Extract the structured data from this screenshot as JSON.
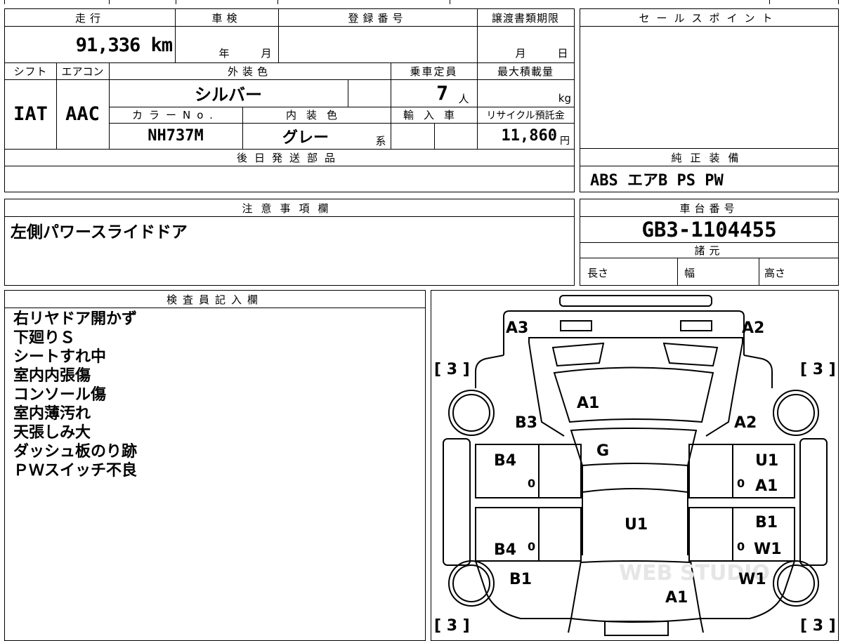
{
  "vehicle_info": {
    "headers": {
      "mileage": "走行",
      "inspection": "車検",
      "registration_no": "登録番号",
      "transfer_deadline": "譲渡書類期限",
      "shift": "シフト",
      "aircon": "エアコン",
      "exterior_color": "外装色",
      "capacity": "乗車定員",
      "max_load": "最大積載量",
      "color_no": "カラーNo.",
      "interior_color": "内装色",
      "import": "輸入車",
      "recycle_fee": "リサイクル預託金",
      "later_parts": "後日発送部品"
    },
    "mileage": "91,336 km",
    "inspection_year_unit": "年",
    "inspection_month_unit": "月",
    "deadline_month_unit": "月",
    "deadline_day_unit": "日",
    "shift": "IAT",
    "aircon": "AAC",
    "exterior_color": "シルバー",
    "capacity": "7",
    "capacity_unit": "人",
    "max_load_unit": "kg",
    "color_no": "NH737M",
    "interior_color": "グレー",
    "interior_suffix": "系",
    "recycle_fee": "11,860",
    "recycle_unit": "円"
  },
  "sale_points": {
    "header": "セールスポイント"
  },
  "genuine_equipment": {
    "header": "純正装備",
    "value": "ABS エアB PS PW"
  },
  "caution": {
    "header": "注意事項欄",
    "text": "左側パワースライドドア"
  },
  "chassis": {
    "header": "車台番号",
    "value": "GB3-1104455"
  },
  "specs": {
    "header": "諸元",
    "length": "長さ",
    "width": "幅",
    "height": "高さ"
  },
  "inspector_notes": {
    "header": "検査員記入欄",
    "lines": [
      "右リヤドア開かず",
      "下廻りＳ",
      "シートすれ中",
      "室内内張傷",
      "コンソール傷",
      "室内薄汚れ",
      "天張しみ大",
      "ダッシュ板のり跡",
      "ＰＷスイッチ不良"
    ]
  },
  "diagram": {
    "tire_tl": "[ 3 ]",
    "tire_tr": "[ 3 ]",
    "tire_bl": "[ 3 ]",
    "tire_br": "[ 3 ]",
    "a3": "A3",
    "a2_top": "A2",
    "a1_hood": "A1",
    "b3": "B3",
    "a2_right": "A2",
    "g": "G",
    "b4_upper": "B4",
    "u1_right": "U1",
    "a1_right": "A1",
    "u1_center": "U1",
    "b1_right": "B1",
    "b4_lower": "B4",
    "w1_right": "W1",
    "b1_left": "B1",
    "w1_rear": "W1",
    "a1_rear": "A1",
    "zero_1": "0",
    "zero_2": "0",
    "zero_3": "0",
    "zero_4": "0",
    "watermark": "WEB STUDIO"
  }
}
